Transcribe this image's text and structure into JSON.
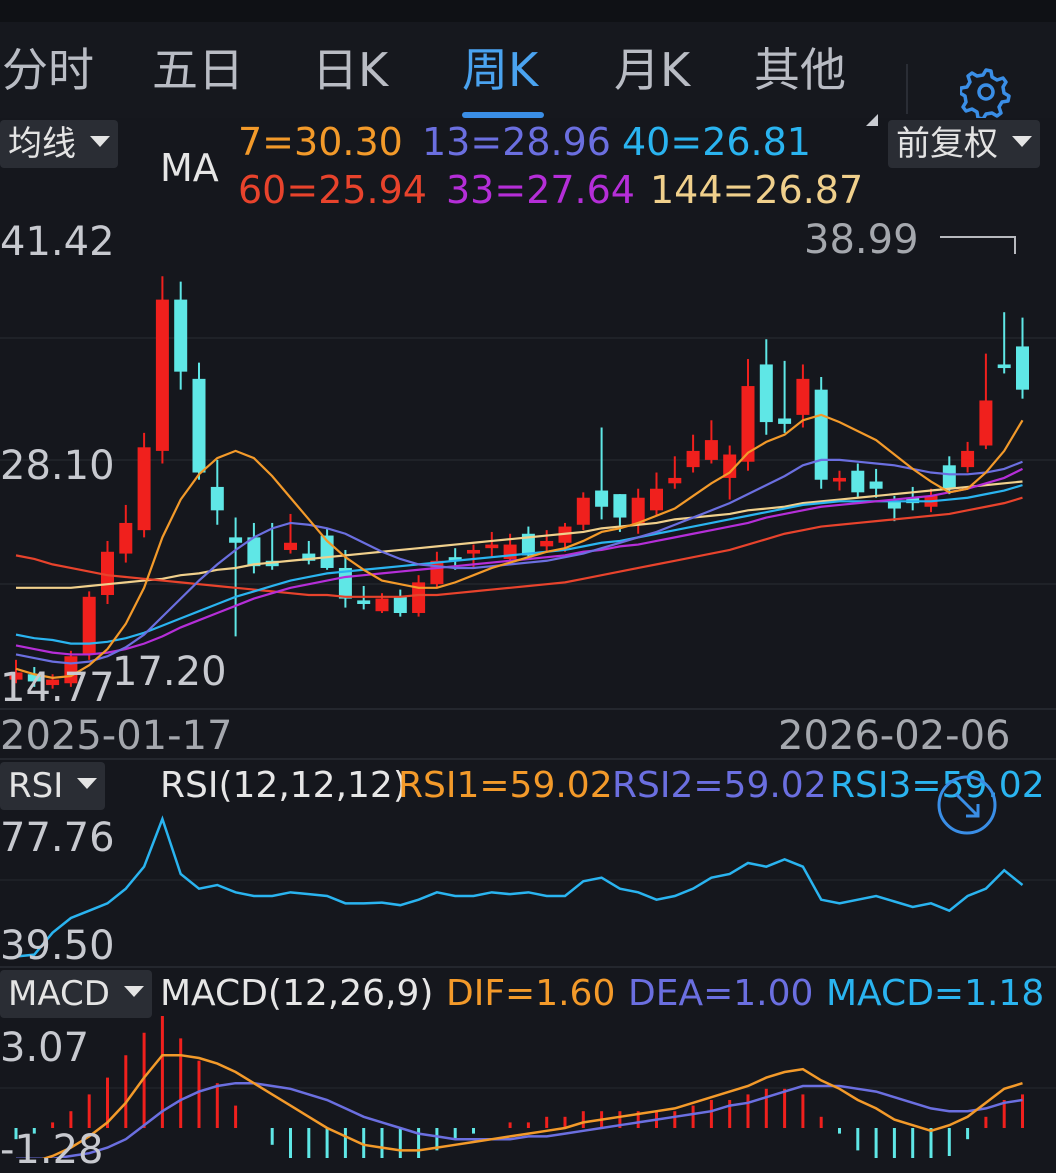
{
  "tabs": [
    {
      "label": "分时",
      "active": false
    },
    {
      "label": "五日",
      "active": false
    },
    {
      "label": "日K",
      "active": false
    },
    {
      "label": "周K",
      "active": true
    },
    {
      "label": "月K",
      "active": false
    },
    {
      "label": "其他",
      "active": false
    }
  ],
  "settings_icon": "gear-icon",
  "ma_panel": {
    "selector": "均线",
    "label": "MA",
    "values": [
      {
        "text": "7=30.30",
        "color": "#f39a2a"
      },
      {
        "text": "13=28.96",
        "color": "#6b6fe0"
      },
      {
        "text": "40=26.81",
        "color": "#2ab4f0"
      },
      {
        "text": "60=25.94",
        "color": "#e8432c"
      },
      {
        "text": "33=27.64",
        "color": "#b52ed8"
      },
      {
        "text": "144=26.87",
        "color": "#f0d08c"
      }
    ],
    "adjust": "前复权",
    "y_top": "41.42",
    "y_mid": "28.10",
    "y_bottom": "14.77",
    "max_label": "38.99",
    "min_label": "17.20",
    "date_start": "2025-01-17",
    "date_end": "2026-02-06"
  },
  "rsi_panel": {
    "selector": "RSI",
    "params": "RSI(12,12,12)",
    "values": [
      {
        "text": "RSI1=59.02",
        "color": "#f39a2a"
      },
      {
        "text": "RSI2=59.02",
        "color": "#6b6fe0"
      },
      {
        "text": "RSI3=59.02",
        "color": "#2ab4f0"
      }
    ],
    "y_top": "77.76",
    "y_bottom": "39.50"
  },
  "macd_panel": {
    "selector": "MACD",
    "params": "MACD(12,26,9)",
    "values": [
      {
        "text": "DIF=1.60",
        "color": "#f39a2a"
      },
      {
        "text": "DEA=1.00",
        "color": "#6b6fe0"
      },
      {
        "text": "MACD=1.18",
        "color": "#2ab4f0"
      }
    ],
    "y_top": "3.07",
    "y_bottom": "-1.28"
  },
  "colors": {
    "up": "#f0201d",
    "down": "#5fe7e6",
    "bg": "#15171d",
    "accent": "#3a8ee6"
  },
  "chart_data": {
    "type": "candlestick",
    "y_range": [
      14.77,
      41.42
    ],
    "candles": [
      [
        15.9,
        16.3,
        17.0,
        15.7
      ],
      [
        16.2,
        15.8,
        16.6,
        15.5
      ],
      [
        15.6,
        15.9,
        16.2,
        15.4
      ],
      [
        15.7,
        17.2,
        17.5,
        15.5
      ],
      [
        17.3,
        20.5,
        20.8,
        17.0
      ],
      [
        20.6,
        23.0,
        23.6,
        20.1
      ],
      [
        22.9,
        24.6,
        25.6,
        22.4
      ],
      [
        24.2,
        28.8,
        29.6,
        23.8
      ],
      [
        28.6,
        37.0,
        38.3,
        27.9
      ],
      [
        37.0,
        33.0,
        38.0,
        32.0
      ],
      [
        32.6,
        27.4,
        33.5,
        27.0
      ],
      [
        26.6,
        25.3,
        28.1,
        24.5
      ],
      [
        23.8,
        23.5,
        24.9,
        18.3
      ],
      [
        23.8,
        22.2,
        24.6,
        21.8
      ],
      [
        22.5,
        22.2,
        24.6,
        22.0
      ],
      [
        23.1,
        23.5,
        25.1,
        22.9
      ],
      [
        22.9,
        22.5,
        23.6,
        22.3
      ],
      [
        23.9,
        22.1,
        24.3,
        22.0
      ],
      [
        22.1,
        20.4,
        23.1,
        19.9
      ],
      [
        20.3,
        20.1,
        21.1,
        19.8
      ],
      [
        19.7,
        20.4,
        20.7,
        19.6
      ],
      [
        20.5,
        19.6,
        20.9,
        19.4
      ],
      [
        19.6,
        21.3,
        21.7,
        19.4
      ],
      [
        21.2,
        22.5,
        23.0,
        21.0
      ],
      [
        22.7,
        22.5,
        23.2,
        22.0
      ],
      [
        22.9,
        23.1,
        23.4,
        22.1
      ],
      [
        23.2,
        23.4,
        24.1,
        22.7
      ],
      [
        22.6,
        23.4,
        24.0,
        22.3
      ],
      [
        24.0,
        22.8,
        24.4,
        22.6
      ],
      [
        23.3,
        23.6,
        24.2,
        23.0
      ],
      [
        23.5,
        24.4,
        24.6,
        23.0
      ],
      [
        24.5,
        26.0,
        26.3,
        24.2
      ],
      [
        26.4,
        25.5,
        29.9,
        24.8
      ],
      [
        26.2,
        24.9,
        26.2,
        24.1
      ],
      [
        24.5,
        26.0,
        26.5,
        24.0
      ],
      [
        25.3,
        26.5,
        27.4,
        25.0
      ],
      [
        26.8,
        27.1,
        28.3,
        26.5
      ],
      [
        27.7,
        28.6,
        29.5,
        27.4
      ],
      [
        28.1,
        29.2,
        30.3,
        27.9
      ],
      [
        27.1,
        28.4,
        28.9,
        25.9
      ],
      [
        28.0,
        32.2,
        33.7,
        27.5
      ],
      [
        33.4,
        30.2,
        34.8,
        29.5
      ],
      [
        30.4,
        30.1,
        33.6,
        29.6
      ],
      [
        30.6,
        32.6,
        33.4,
        29.9
      ],
      [
        32.0,
        27.0,
        32.7,
        26.5
      ],
      [
        26.9,
        27.1,
        27.5,
        26.4
      ],
      [
        27.5,
        26.3,
        27.9,
        26.0
      ],
      [
        26.9,
        26.5,
        27.6,
        26.0
      ],
      [
        25.8,
        25.4,
        26.1,
        24.7
      ],
      [
        26.0,
        25.7,
        26.6,
        25.3
      ],
      [
        25.5,
        26.1,
        26.5,
        25.2
      ],
      [
        27.8,
        26.5,
        28.3,
        26.2
      ],
      [
        27.7,
        28.6,
        29.1,
        27.4
      ],
      [
        28.9,
        31.4,
        34.0,
        28.7
      ],
      [
        33.4,
        33.2,
        36.3,
        32.9
      ],
      [
        34.4,
        32.0,
        36.0,
        31.5
      ]
    ],
    "ma": {
      "ma7": [
        16.5,
        16.2,
        16.0,
        16.1,
        16.7,
        17.6,
        19.0,
        21.0,
        23.8,
        25.9,
        27.3,
        28.2,
        28.6,
        28.2,
        27.2,
        26.0,
        24.8,
        23.6,
        22.7,
        22.0,
        21.4,
        21.2,
        21.0,
        21.0,
        21.3,
        21.7,
        22.1,
        22.4,
        22.7,
        23.0,
        23.2,
        23.6,
        24.1,
        24.3,
        24.6,
        25.0,
        25.4,
        26.1,
        26.8,
        27.4,
        28.5,
        29.1,
        29.5,
        30.3,
        30.6,
        30.2,
        29.7,
        29.2,
        28.4,
        27.6,
        26.9,
        26.3,
        26.5,
        27.4,
        28.6,
        30.3
      ],
      "ma13": [
        17.3,
        17.1,
        16.9,
        16.8,
        16.9,
        17.2,
        17.7,
        18.4,
        19.4,
        20.4,
        21.4,
        22.3,
        23.1,
        23.8,
        24.3,
        24.6,
        24.5,
        24.3,
        24.0,
        23.5,
        23.0,
        22.6,
        22.3,
        22.2,
        22.1,
        22.1,
        22.2,
        22.3,
        22.4,
        22.5,
        22.7,
        22.9,
        23.2,
        23.5,
        23.8,
        24.1,
        24.5,
        24.9,
        25.3,
        25.7,
        26.2,
        26.7,
        27.2,
        27.8,
        28.1,
        28.1,
        28.0,
        27.9,
        27.8,
        27.6,
        27.4,
        27.3,
        27.3,
        27.4,
        27.6,
        28.0
      ],
      "ma40": [
        18.4,
        18.2,
        18.1,
        17.9,
        17.9,
        18.0,
        18.2,
        18.5,
        18.9,
        19.3,
        19.7,
        20.1,
        20.5,
        20.8,
        21.1,
        21.4,
        21.6,
        21.8,
        21.9,
        22.0,
        22.1,
        22.2,
        22.3,
        22.4,
        22.5,
        22.6,
        22.7,
        22.8,
        22.9,
        23.0,
        23.1,
        23.3,
        23.5,
        23.6,
        23.8,
        24.0,
        24.2,
        24.4,
        24.6,
        24.8,
        25.0,
        25.2,
        25.4,
        25.6,
        25.7,
        25.8,
        25.8,
        25.8,
        25.8,
        25.8,
        25.8,
        25.9,
        26.0,
        26.2,
        26.4,
        26.7
      ],
      "ma60": [
        22.8,
        22.6,
        22.3,
        22.1,
        21.9,
        21.7,
        21.6,
        21.5,
        21.4,
        21.3,
        21.2,
        21.1,
        21.0,
        20.9,
        20.8,
        20.7,
        20.6,
        20.6,
        20.5,
        20.5,
        20.5,
        20.5,
        20.6,
        20.6,
        20.7,
        20.8,
        20.9,
        21.0,
        21.1,
        21.2,
        21.3,
        21.5,
        21.7,
        21.9,
        22.1,
        22.3,
        22.5,
        22.7,
        22.9,
        23.1,
        23.4,
        23.7,
        24.0,
        24.2,
        24.4,
        24.5,
        24.6,
        24.7,
        24.8,
        24.9,
        25.0,
        25.1,
        25.3,
        25.5,
        25.7,
        26.0
      ],
      "ma33": [
        17.8,
        17.6,
        17.4,
        17.3,
        17.3,
        17.4,
        17.6,
        17.9,
        18.3,
        18.8,
        19.2,
        19.6,
        20.0,
        20.4,
        20.7,
        21.0,
        21.2,
        21.4,
        21.6,
        21.7,
        21.8,
        21.9,
        22.0,
        22.1,
        22.2,
        22.3,
        22.4,
        22.5,
        22.6,
        22.7,
        22.8,
        23.0,
        23.1,
        23.3,
        23.4,
        23.6,
        23.8,
        24.0,
        24.2,
        24.4,
        24.6,
        24.9,
        25.1,
        25.3,
        25.5,
        25.6,
        25.7,
        25.8,
        25.9,
        26.0,
        26.1,
        26.3,
        26.5,
        26.8,
        27.1,
        27.6
      ],
      "ma144": [
        21.0,
        21.0,
        21.0,
        21.0,
        21.1,
        21.2,
        21.3,
        21.4,
        21.5,
        21.7,
        21.8,
        22.0,
        22.1,
        22.3,
        22.4,
        22.5,
        22.6,
        22.7,
        22.8,
        22.9,
        23.0,
        23.1,
        23.2,
        23.3,
        23.4,
        23.5,
        23.6,
        23.7,
        23.8,
        23.9,
        24.0,
        24.1,
        24.3,
        24.4,
        24.5,
        24.6,
        24.8,
        24.9,
        25.0,
        25.1,
        25.3,
        25.4,
        25.5,
        25.7,
        25.8,
        25.9,
        26.0,
        26.1,
        26.2,
        26.3,
        26.4,
        26.5,
        26.6,
        26.7,
        26.8,
        26.9
      ]
    },
    "rsi": [
      39.5,
      40,
      46,
      50,
      52,
      54,
      58,
      64,
      77,
      62,
      58,
      59,
      57,
      56,
      56,
      57,
      56.5,
      56,
      54,
      54,
      54.2,
      53.5,
      55,
      57,
      56,
      56,
      57,
      56.5,
      57,
      56,
      56,
      60,
      61,
      58,
      57,
      55,
      56,
      58,
      61,
      62,
      65,
      64,
      66,
      64,
      55,
      54,
      55,
      56,
      54.5,
      53,
      54,
      52,
      56,
      58,
      63,
      59
    ],
    "dif": [
      -1.3,
      -1.2,
      -1.0,
      -0.7,
      -0.3,
      0.2,
      0.9,
      1.8,
      2.6,
      2.6,
      2.5,
      2.3,
      2.0,
      1.6,
      1.2,
      0.8,
      0.4,
      0.0,
      -0.3,
      -0.6,
      -0.7,
      -0.8,
      -0.8,
      -0.7,
      -0.6,
      -0.5,
      -0.4,
      -0.3,
      -0.2,
      -0.1,
      0.0,
      0.2,
      0.3,
      0.4,
      0.5,
      0.6,
      0.7,
      0.9,
      1.1,
      1.3,
      1.5,
      1.8,
      2.0,
      2.1,
      1.7,
      1.4,
      1.0,
      0.7,
      0.3,
      0.1,
      -0.1,
      0.1,
      0.4,
      0.9,
      1.4,
      1.6
    ],
    "dea": [
      -1.1,
      -1.1,
      -1.1,
      -1.0,
      -0.9,
      -0.7,
      -0.4,
      0.1,
      0.6,
      1.0,
      1.3,
      1.5,
      1.6,
      1.6,
      1.5,
      1.4,
      1.2,
      1.0,
      0.7,
      0.4,
      0.2,
      0.0,
      -0.2,
      -0.3,
      -0.4,
      -0.4,
      -0.4,
      -0.4,
      -0.3,
      -0.3,
      -0.2,
      -0.1,
      0.0,
      0.1,
      0.2,
      0.3,
      0.4,
      0.5,
      0.6,
      0.8,
      0.9,
      1.1,
      1.3,
      1.5,
      1.5,
      1.5,
      1.4,
      1.3,
      1.1,
      0.9,
      0.7,
      0.6,
      0.6,
      0.7,
      0.9,
      1.0
    ]
  }
}
